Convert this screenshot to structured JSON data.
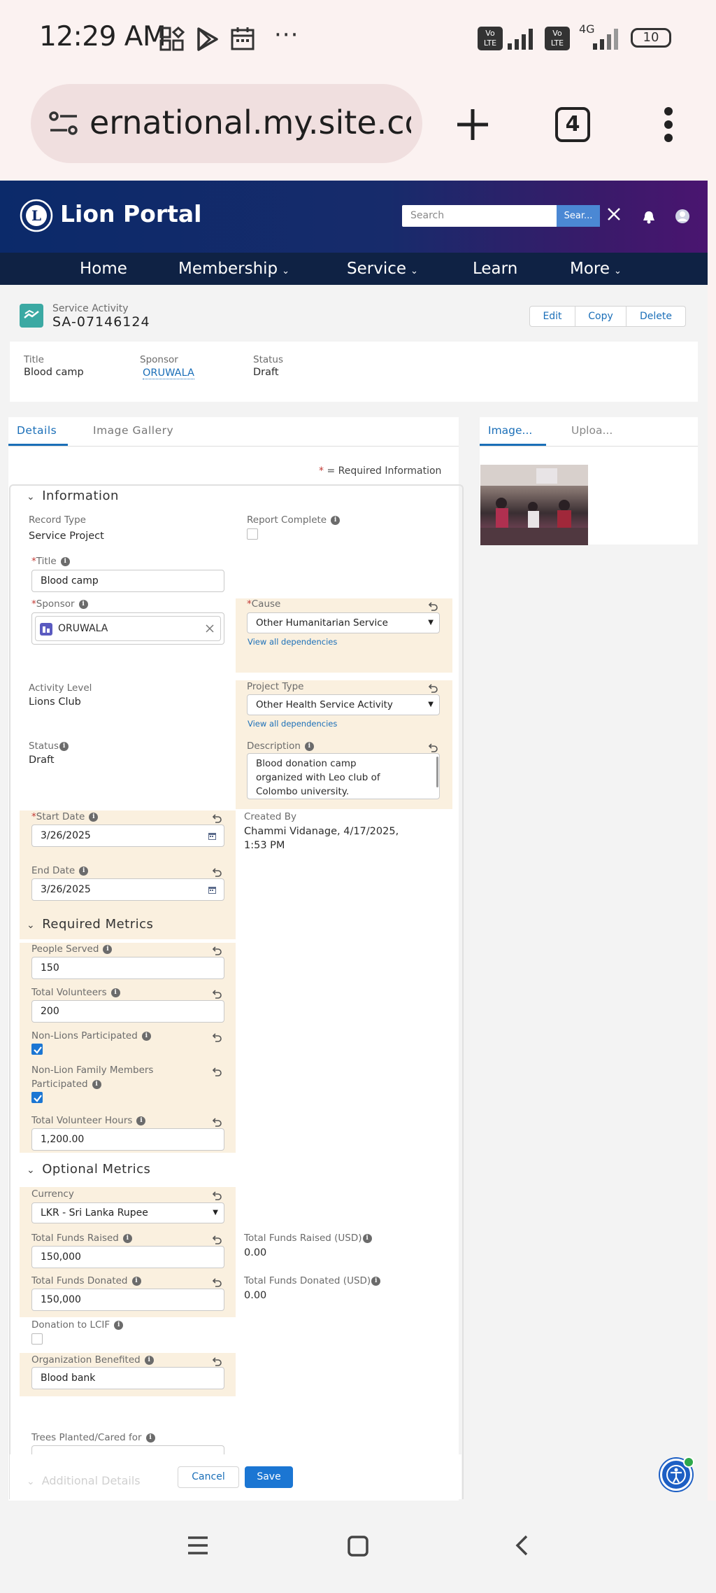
{
  "status_bar": {
    "time": "12:29 AM",
    "ellipsis": "···",
    "network": "4G",
    "battery": "10"
  },
  "browser": {
    "url": "ernational.my.site.com",
    "tab_count": "4"
  },
  "header": {
    "title": "Lion Portal",
    "search_placeholder": "Search",
    "search_button": "Sear..."
  },
  "nav": {
    "items": [
      "Home",
      "Membership",
      "Service",
      "Learn",
      "More"
    ]
  },
  "record": {
    "object_label": "Service Activity",
    "id": "SA-07146124",
    "actions": [
      "Edit",
      "Copy",
      "Delete"
    ],
    "highlights": [
      {
        "label": "Title",
        "value": "Blood camp"
      },
      {
        "label": "Sponsor",
        "value": "ORUWALA"
      },
      {
        "label": "Status",
        "value": "Draft"
      }
    ]
  },
  "tabs": [
    "Details",
    "Image Gallery"
  ],
  "side_tabs": [
    "Image...",
    "Uploa..."
  ],
  "required_info": "= Required Information",
  "sections": {
    "information": "Information",
    "required_metrics": "Required Metrics",
    "optional_metrics": "Optional Metrics",
    "additional": "Additional Details"
  },
  "fields": {
    "record_type": {
      "label": "Record Type",
      "value": "Service Project"
    },
    "report_complete": {
      "label": "Report Complete"
    },
    "title": {
      "label": "Title",
      "value": "Blood camp"
    },
    "sponsor": {
      "label": "Sponsor",
      "value": "ORUWALA"
    },
    "cause": {
      "label": "Cause",
      "value": "Other Humanitarian Service",
      "link": "View all dependencies"
    },
    "activity_level": {
      "label": "Activity Level",
      "value": "Lions Club"
    },
    "project_type": {
      "label": "Project Type",
      "value": "Other Health Service Activity",
      "link": "View all dependencies"
    },
    "status": {
      "label": "Status",
      "value": "Draft"
    },
    "description": {
      "label": "Description",
      "line1": "Blood donation camp",
      "line2": "organized with Leo club of",
      "line3": "Colombo university."
    },
    "start_date": {
      "label": "Start Date",
      "value": "3/26/2025"
    },
    "end_date": {
      "label": "End Date",
      "value": "3/26/2025"
    },
    "created_by": {
      "label": "Created By",
      "line1": "Chammi Vidanage, 4/17/2025,",
      "line2": "1:53 PM"
    },
    "people_served": {
      "label": "People Served",
      "value": "150"
    },
    "total_volunteers": {
      "label": "Total Volunteers",
      "value": "200"
    },
    "non_lions": {
      "label": "Non-Lions Participated"
    },
    "non_lion_family": {
      "label1": "Non-Lion Family Members",
      "label2": "Participated"
    },
    "volunteer_hours": {
      "label": "Total Volunteer Hours",
      "value": "1,200.00"
    },
    "currency": {
      "label": "Currency",
      "value": "LKR - Sri Lanka Rupee"
    },
    "funds_raised": {
      "label": "Total Funds Raised",
      "value": "150,000"
    },
    "funds_raised_usd": {
      "label": "Total Funds Raised (USD)",
      "value": "0.00"
    },
    "funds_donated": {
      "label": "Total Funds Donated",
      "value": "150,000"
    },
    "funds_donated_usd": {
      "label": "Total Funds Donated (USD)",
      "value": "0.00"
    },
    "lcif": {
      "label": "Donation to LCIF"
    },
    "org_benefited": {
      "label": "Organization Benefited",
      "value": "Blood bank"
    },
    "trees": {
      "label": "Trees Planted/Cared for"
    }
  },
  "form_buttons": {
    "cancel": "Cancel",
    "save": "Save"
  },
  "colors": {
    "brand_blue": "#0b2a6a",
    "nav_dark": "#0f2244",
    "accent": "#1b76d3",
    "edited_bg": "#faf0df"
  }
}
